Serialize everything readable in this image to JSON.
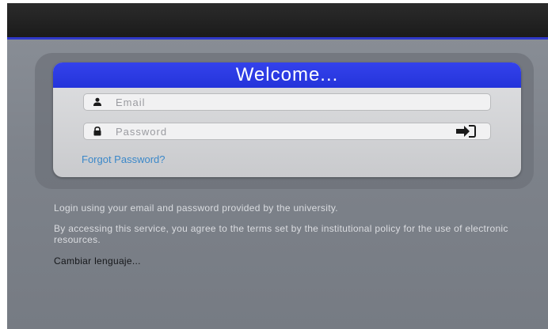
{
  "header": {
    "title": "Welcome..."
  },
  "login": {
    "email_placeholder": "Email",
    "password_placeholder": "Password",
    "email_icon": "user-icon",
    "password_icon": "lock-icon",
    "submit_icon": "sign-in-icon",
    "forgot_label": "Forgot Password?"
  },
  "info": {
    "line1": "Login using your email and password provided by the university.",
    "line2": "By accessing this service, you agree to the terms set by the institutional policy for the use of electronic resources."
  },
  "language": {
    "label": "Cambiar lenguaje..."
  },
  "colors": {
    "accent": "#2f39c9",
    "header_blue": "#2a38e0",
    "link": "#3b88c9",
    "background": "#80858d"
  }
}
